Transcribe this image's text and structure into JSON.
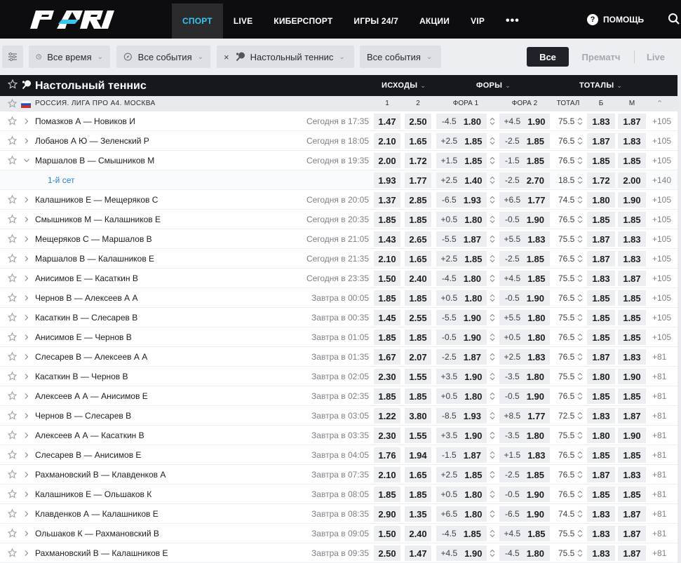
{
  "header": {
    "logo": "PARI",
    "nav": [
      "СПОРТ",
      "LIVE",
      "КИБЕРСПОРТ",
      "ИГРЫ 24/7",
      "АКЦИИ",
      "VIP",
      "•••"
    ],
    "help": "ПОМОЩЬ"
  },
  "filters": {
    "time": "Все время",
    "events1": "Все события",
    "sport": "Настольный теннис",
    "events2": "Все события",
    "seg_all": "Все",
    "seg_prematch": "Прематч",
    "seg_live": "Live"
  },
  "table": {
    "sport": "Настольный теннис",
    "col_outcomes": "ИСХОДЫ",
    "col_handicaps": "ФОРЫ",
    "col_totals": "ТОТАЛЫ",
    "league": "РОССИЯ. ЛИГА ПРО А4. МОСКВА",
    "sub_1": "1",
    "sub_2": "2",
    "sub_f1": "ФОРА 1",
    "sub_f2": "ФОРА 2",
    "sub_total": "ТОТАЛ",
    "sub_b": "Б",
    "sub_m": "М"
  },
  "rows": [
    {
      "teams": "Помазков А — Новиков И",
      "time": "Сегодня в 17:35",
      "o1": "1.47",
      "o2": "2.50",
      "f1p": "-4.5",
      "f1": "1.80",
      "f2p": "+4.5",
      "f2": "1.90",
      "tp": "75.5",
      "b": "1.83",
      "m": "1.87",
      "more": "+105"
    },
    {
      "teams": "Лобанов А Ю — Зеленский Р",
      "time": "Сегодня в 18:05",
      "o1": "2.10",
      "o2": "1.65",
      "f1p": "+2.5",
      "f1": "1.85",
      "f2p": "-2.5",
      "f2": "1.85",
      "tp": "76.5",
      "b": "1.87",
      "m": "1.83",
      "more": "+105"
    },
    {
      "teams": "Маршалов В — Смышников М",
      "time": "Сегодня в 19:35",
      "o1": "2.00",
      "o2": "1.72",
      "f1p": "+1.5",
      "f1": "1.85",
      "f2p": "-1.5",
      "f2": "1.85",
      "tp": "76.5",
      "b": "1.85",
      "m": "1.85",
      "more": "+105",
      "expanded": true
    },
    {
      "set": "1-й сет",
      "o1": "1.93",
      "o2": "1.77",
      "f1p": "+2.5",
      "f1": "1.40",
      "f2p": "-2.5",
      "f2": "2.70",
      "tp": "18.5",
      "b": "1.72",
      "m": "2.00",
      "more": "+140"
    },
    {
      "teams": "Калашников Е — Мещеряков С",
      "time": "Сегодня в 20:05",
      "o1": "1.37",
      "o2": "2.85",
      "f1p": "-6.5",
      "f1": "1.93",
      "f2p": "+6.5",
      "f2": "1.77",
      "tp": "74.5",
      "b": "1.80",
      "m": "1.90",
      "more": "+105"
    },
    {
      "teams": "Смышников М — Калашников Е",
      "time": "Сегодня в 20:35",
      "o1": "1.85",
      "o2": "1.85",
      "f1p": "+0.5",
      "f1": "1.80",
      "f2p": "-0.5",
      "f2": "1.90",
      "tp": "76.5",
      "b": "1.85",
      "m": "1.85",
      "more": "+105"
    },
    {
      "teams": "Мещеряков С — Маршалов В",
      "time": "Сегодня в 21:05",
      "o1": "1.43",
      "o2": "2.65",
      "f1p": "-5.5",
      "f1": "1.87",
      "f2p": "+5.5",
      "f2": "1.83",
      "tp": "75.5",
      "b": "1.87",
      "m": "1.83",
      "more": "+105"
    },
    {
      "teams": "Маршалов В — Калашников Е",
      "time": "Сегодня в 21:35",
      "o1": "2.10",
      "o2": "1.65",
      "f1p": "+2.5",
      "f1": "1.85",
      "f2p": "-2.5",
      "f2": "1.85",
      "tp": "76.5",
      "b": "1.87",
      "m": "1.83",
      "more": "+105"
    },
    {
      "teams": "Анисимов Е — Касаткин В",
      "time": "Сегодня в 23:35",
      "o1": "1.50",
      "o2": "2.40",
      "f1p": "-4.5",
      "f1": "1.80",
      "f2p": "+4.5",
      "f2": "1.85",
      "tp": "75.5",
      "b": "1.83",
      "m": "1.87",
      "more": "+105"
    },
    {
      "teams": "Чернов В — Алексеев А А",
      "time": "Завтра в 00:05",
      "o1": "1.85",
      "o2": "1.85",
      "f1p": "+0.5",
      "f1": "1.80",
      "f2p": "-0.5",
      "f2": "1.90",
      "tp": "76.5",
      "b": "1.85",
      "m": "1.85",
      "more": "+105"
    },
    {
      "teams": "Касаткин В — Слесарев В",
      "time": "Завтра в 00:35",
      "o1": "1.45",
      "o2": "2.55",
      "f1p": "-5.5",
      "f1": "1.90",
      "f2p": "+5.5",
      "f2": "1.80",
      "tp": "75.5",
      "b": "1.85",
      "m": "1.85",
      "more": "+105"
    },
    {
      "teams": "Анисимов Е — Чернов В",
      "time": "Завтра в 01:05",
      "o1": "1.85",
      "o2": "1.85",
      "f1p": "-0.5",
      "f1": "1.90",
      "f2p": "+0.5",
      "f2": "1.80",
      "tp": "76.5",
      "b": "1.85",
      "m": "1.85",
      "more": "+105"
    },
    {
      "teams": "Слесарев В — Алексеев А А",
      "time": "Завтра в 01:35",
      "o1": "1.67",
      "o2": "2.07",
      "f1p": "-2.5",
      "f1": "1.87",
      "f2p": "+2.5",
      "f2": "1.83",
      "tp": "76.5",
      "b": "1.87",
      "m": "1.83",
      "more": "+81"
    },
    {
      "teams": "Касаткин В — Чернов В",
      "time": "Завтра в 02:05",
      "o1": "2.30",
      "o2": "1.55",
      "f1p": "+3.5",
      "f1": "1.90",
      "f2p": "-3.5",
      "f2": "1.80",
      "tp": "75.5",
      "b": "1.80",
      "m": "1.90",
      "more": "+81"
    },
    {
      "teams": "Алексеев А А — Анисимов Е",
      "time": "Завтра в 02:35",
      "o1": "1.85",
      "o2": "1.85",
      "f1p": "+0.5",
      "f1": "1.80",
      "f2p": "-0.5",
      "f2": "1.90",
      "tp": "76.5",
      "b": "1.85",
      "m": "1.85",
      "more": "+81"
    },
    {
      "teams": "Чернов В — Слесарев В",
      "time": "Завтра в 03:05",
      "o1": "1.22",
      "o2": "3.80",
      "f1p": "-8.5",
      "f1": "1.93",
      "f2p": "+8.5",
      "f2": "1.77",
      "tp": "72.5",
      "b": "1.83",
      "m": "1.87",
      "more": "+81"
    },
    {
      "teams": "Алексеев А А — Касаткин В",
      "time": "Завтра в 03:35",
      "o1": "2.30",
      "o2": "1.55",
      "f1p": "+3.5",
      "f1": "1.90",
      "f2p": "-3.5",
      "f2": "1.80",
      "tp": "75.5",
      "b": "1.80",
      "m": "1.90",
      "more": "+81"
    },
    {
      "teams": "Слесарев В — Анисимов Е",
      "time": "Завтра в 04:05",
      "o1": "1.76",
      "o2": "1.94",
      "f1p": "-1.5",
      "f1": "1.87",
      "f2p": "+1.5",
      "f2": "1.83",
      "tp": "76.5",
      "b": "1.85",
      "m": "1.85",
      "more": "+81"
    },
    {
      "teams": "Рахмановский В — Клавденков А",
      "time": "Завтра в 07:35",
      "o1": "2.10",
      "o2": "1.65",
      "f1p": "+2.5",
      "f1": "1.85",
      "f2p": "-2.5",
      "f2": "1.85",
      "tp": "76.5",
      "b": "1.87",
      "m": "1.83",
      "more": "+81"
    },
    {
      "teams": "Калашников Е — Ольшаков К",
      "time": "Завтра в 08:05",
      "o1": "1.85",
      "o2": "1.85",
      "f1p": "+0.5",
      "f1": "1.80",
      "f2p": "-0.5",
      "f2": "1.90",
      "tp": "76.5",
      "b": "1.85",
      "m": "1.85",
      "more": "+81"
    },
    {
      "teams": "Клавденков А — Калашников Е",
      "time": "Завтра в 08:35",
      "o1": "2.90",
      "o2": "1.35",
      "f1p": "+6.5",
      "f1": "1.80",
      "f2p": "-6.5",
      "f2": "1.90",
      "tp": "74.5",
      "b": "1.83",
      "m": "1.87",
      "more": "+81"
    },
    {
      "teams": "Ольшаков К — Рахмановский В",
      "time": "Завтра в 09:05",
      "o1": "1.50",
      "o2": "2.40",
      "f1p": "-4.5",
      "f1": "1.85",
      "f2p": "+4.5",
      "f2": "1.85",
      "tp": "75.5",
      "b": "1.83",
      "m": "1.87",
      "more": "+81"
    },
    {
      "teams": "Рахмановский В — Калашников Е",
      "time": "Завтра в 09:35",
      "o1": "2.50",
      "o2": "1.47",
      "f1p": "+4.5",
      "f1": "1.90",
      "f2p": "-4.5",
      "f2": "1.80",
      "tp": "75.5",
      "b": "1.83",
      "m": "1.87",
      "more": "+81"
    }
  ]
}
